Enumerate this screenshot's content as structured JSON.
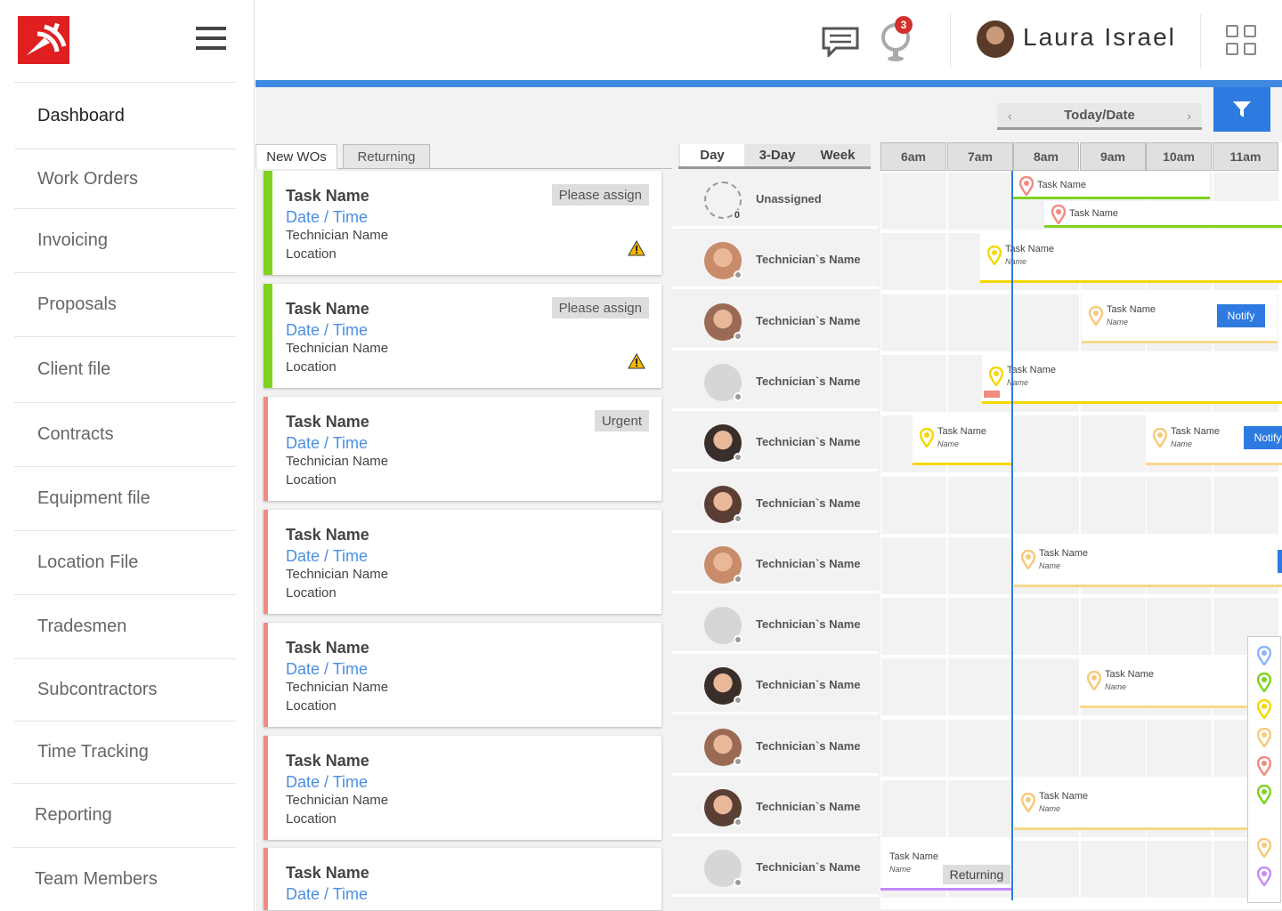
{
  "user": {
    "name": "Laura Israel",
    "notifications": "3"
  },
  "sidebar": {
    "items": [
      {
        "label": "Dashboard"
      },
      {
        "label": "Work Orders"
      },
      {
        "label": "Invoicing"
      },
      {
        "label": "Proposals"
      },
      {
        "label": "Client file"
      },
      {
        "label": "Contracts"
      },
      {
        "label": "Equipment file"
      },
      {
        "label": "Location File"
      },
      {
        "label": "Tradesmen"
      },
      {
        "label": "Subcontractors"
      },
      {
        "label": "Time Tracking"
      },
      {
        "label": "Reporting"
      },
      {
        "label": "Team Members"
      }
    ]
  },
  "toolbar": {
    "today_label": "Today/Date"
  },
  "wo_tabs": {
    "new": "New WOs",
    "returning": "Returning"
  },
  "view_tabs": {
    "day": "Day",
    "three_day": "3-Day",
    "week": "Week"
  },
  "times": [
    "6am",
    "7am",
    "8am",
    "9am",
    "10am",
    "11am"
  ],
  "cards": [
    {
      "title": "Task Name",
      "date": "Date / Time",
      "tech": "Technician Name",
      "location": "Location",
      "tag": "Please assign",
      "stripe": "#7ed321",
      "warning": true
    },
    {
      "title": "Task Name",
      "date": "Date / Time",
      "tech": "Technician Name",
      "location": "Location",
      "tag": "Please assign",
      "stripe": "#7ed321",
      "warning": true
    },
    {
      "title": "Task Name",
      "date": "Date / Time",
      "tech": "Technician Name",
      "location": "Location",
      "tag": "Urgent",
      "stripe": "#f28b82",
      "warning": false
    },
    {
      "title": "Task Name",
      "date": "Date / Time",
      "tech": "Technician Name",
      "location": "Location",
      "tag": "",
      "stripe": "#f28b82",
      "warning": false
    },
    {
      "title": "Task Name",
      "date": "Date / Time",
      "tech": "Technician Name",
      "location": "Location",
      "tag": "",
      "stripe": "#f28b82",
      "warning": false
    },
    {
      "title": "Task Name",
      "date": "Date / Time",
      "tech": "Technician Name",
      "location": "Location",
      "tag": "",
      "stripe": "#f28b82",
      "warning": false
    },
    {
      "title": "Task Name",
      "date": "Date / Time",
      "tech": "",
      "location": "",
      "tag": "",
      "stripe": "#f28b82",
      "warning": false
    }
  ],
  "technicians": [
    {
      "name": "Unassigned",
      "count": "0"
    },
    {
      "name": "Technician`s Name"
    },
    {
      "name": "Technician`s Name"
    },
    {
      "name": "Technician`s Name"
    },
    {
      "name": "Technician`s Name"
    },
    {
      "name": "Technician`s Name"
    },
    {
      "name": "Technician`s Name"
    },
    {
      "name": "Technician`s Name"
    },
    {
      "name": "Technician`s Name"
    },
    {
      "name": "Technician`s Name"
    },
    {
      "name": "Technician`s Name"
    },
    {
      "name": "Technician`s Name"
    }
  ],
  "tasks": {
    "task_name": "Task Name",
    "name_label": "Name",
    "notify": "Notify",
    "returning": "Returning"
  },
  "colors": {
    "accent": "#2d7be0",
    "green": "#7ed321",
    "red": "#f28b82",
    "yellow": "#f7d98c"
  }
}
